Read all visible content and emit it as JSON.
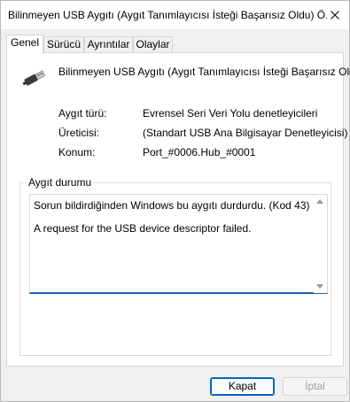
{
  "window": {
    "title": "Bilinmeyen USB Aygıtı (Aygıt Tanımlayıcısı İsteği Başarısız Oldu) Ö...",
    "close_icon": "close-icon"
  },
  "tabs": [
    {
      "label": "Genel",
      "active": true
    },
    {
      "label": "Sürücü",
      "active": false
    },
    {
      "label": "Ayrıntılar",
      "active": false
    },
    {
      "label": "Olaylar",
      "active": false
    }
  ],
  "device": {
    "icon": "usb-device-icon",
    "name": "Bilinmeyen USB Aygıtı (Aygıt Tanımlayıcısı İsteği Başarısız Oldu)"
  },
  "properties": [
    {
      "label": "Aygıt türü:",
      "value": "Evrensel Seri Veri Yolu denetleyicileri"
    },
    {
      "label": "Üreticisi:",
      "value": "(Standart USB Ana Bilgisayar Denetleyicisi)"
    },
    {
      "label": "Konum:",
      "value": "Port_#0006.Hub_#0001"
    }
  ],
  "status": {
    "group_label": "Aygıt durumu",
    "line1": "Sorun bildirdiğinden Windows bu aygıtı durdurdu. (Kod 43)",
    "line2": "A request for the USB device descriptor failed."
  },
  "buttons": {
    "ok": "Kapat",
    "cancel": "İptal"
  },
  "colors": {
    "accent": "#0067c0",
    "focus_underline": "#1e5fa8"
  }
}
